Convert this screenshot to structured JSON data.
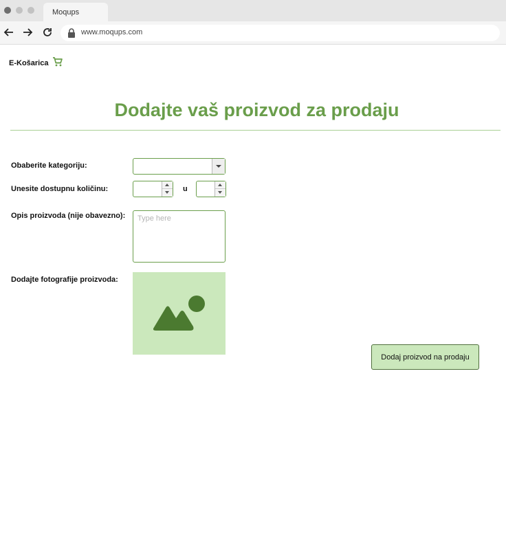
{
  "browser": {
    "tab_title": "Moqups",
    "url": "www.moqups.com"
  },
  "header": {
    "brand": "E-Košarica",
    "cart_icon": "shopping-cart-icon"
  },
  "main": {
    "title": "Dodajte vaš proizvod za prodaju",
    "category_label": "Obaberite kategoriju:",
    "category_value": "",
    "quantity_label": "Unesite dostupnu količinu:",
    "quantity_separator": "u",
    "quantity_value": "",
    "unit_value": "",
    "description_label": "Opis proizvoda (nije obavezno):",
    "description_placeholder": "Type here",
    "photos_label": "Dodajte fotografije proizvoda:",
    "submit_label": "Dodaj proizvod na prodaju"
  },
  "colors": {
    "accent": "#6a9e4b",
    "accent_light": "#cbe8bc",
    "icon_dark": "#4b7a30"
  }
}
